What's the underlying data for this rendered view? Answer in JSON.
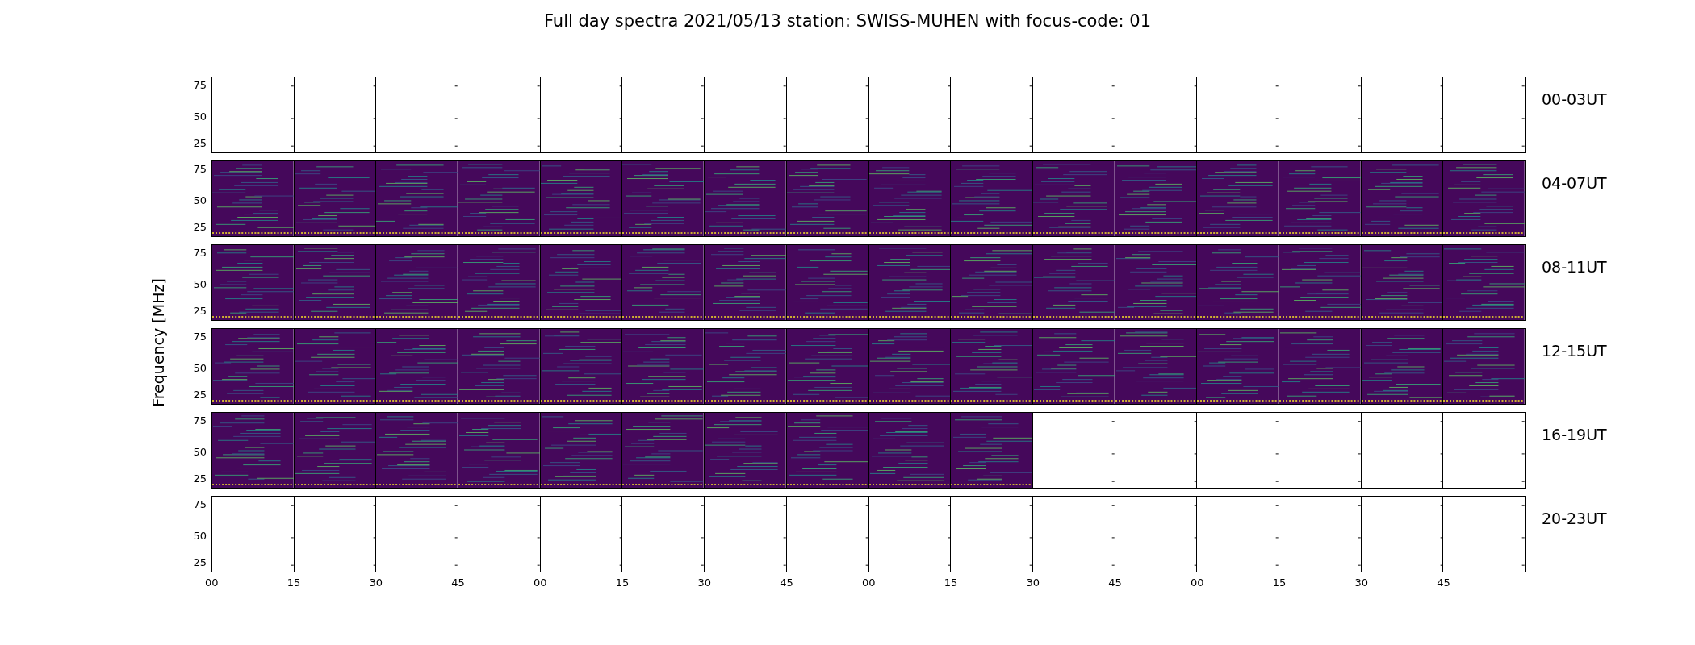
{
  "title": "Full day spectra 2021/05/13 station: SWISS-MUHEN with focus-code: 01",
  "y_axis_label": "Frequency [MHz]",
  "rows": [
    {
      "label": "00-03UT",
      "yticks": [
        "75",
        "50",
        "25"
      ],
      "panels": [
        false,
        false,
        false,
        false,
        false,
        false,
        false,
        false,
        false,
        false,
        false,
        false,
        false,
        false,
        false,
        false
      ]
    },
    {
      "label": "04-07UT",
      "yticks": [
        "75",
        "50",
        "25"
      ],
      "panels": [
        true,
        true,
        true,
        true,
        true,
        true,
        true,
        true,
        true,
        true,
        true,
        true,
        true,
        true,
        true,
        true
      ]
    },
    {
      "label": "08-11UT",
      "yticks": [
        "75",
        "50",
        "25"
      ],
      "panels": [
        true,
        true,
        true,
        true,
        true,
        true,
        true,
        true,
        true,
        true,
        true,
        true,
        true,
        true,
        true,
        true
      ]
    },
    {
      "label": "12-15UT",
      "yticks": [
        "75",
        "50",
        "25"
      ],
      "panels": [
        true,
        true,
        true,
        true,
        true,
        true,
        true,
        true,
        true,
        true,
        true,
        true,
        true,
        true,
        true,
        true
      ]
    },
    {
      "label": "16-19UT",
      "yticks": [
        "75",
        "50",
        "25"
      ],
      "panels": [
        true,
        true,
        true,
        true,
        true,
        true,
        true,
        true,
        true,
        true,
        false,
        false,
        false,
        false,
        false,
        false
      ]
    },
    {
      "label": "20-23UT",
      "yticks": [
        "75",
        "50",
        "25"
      ],
      "panels": [
        false,
        false,
        false,
        false,
        false,
        false,
        false,
        false,
        false,
        false,
        false,
        false,
        false,
        false,
        false,
        false
      ]
    }
  ],
  "xticks": [
    "00",
    "15",
    "30",
    "45",
    "00",
    "15",
    "30",
    "45",
    "00",
    "15",
    "30",
    "45",
    "00",
    "15",
    "30",
    "45"
  ]
}
